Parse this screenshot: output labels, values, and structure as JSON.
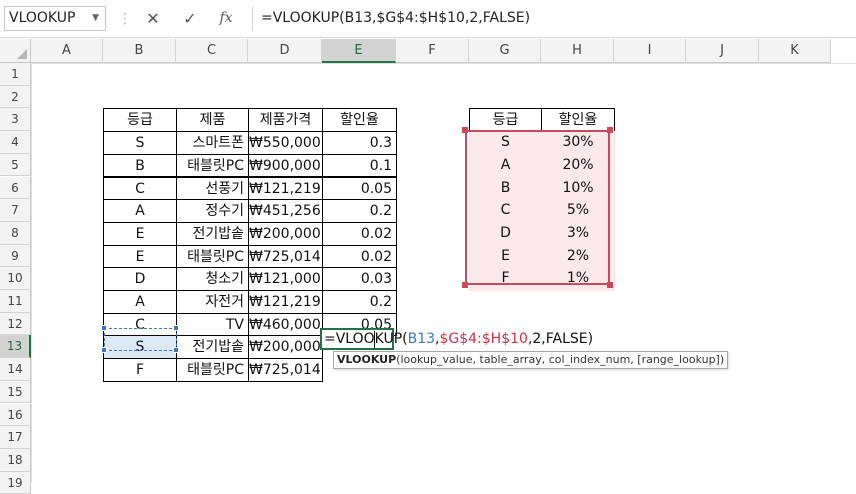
{
  "name_box": "VLOOKUP",
  "formula_bar": {
    "cancel_icon": "✕",
    "enter_icon": "✓",
    "fx_label": "fx",
    "formula": "=VLOOKUP(B13,$G$4:$H$10,2,FALSE)"
  },
  "columns": [
    "A",
    "B",
    "C",
    "D",
    "E",
    "F",
    "G",
    "H",
    "I",
    "J",
    "K"
  ],
  "rows": [
    "1",
    "2",
    "3",
    "4",
    "5",
    "6",
    "7",
    "8",
    "9",
    "10",
    "11",
    "12",
    "13",
    "14",
    "15",
    "16",
    "17",
    "18",
    "19"
  ],
  "table1": {
    "headers": [
      "등급",
      "제품",
      "제품가격",
      "할인율"
    ],
    "rows": [
      [
        "S",
        "스마트폰",
        "₩550,000",
        "0.3"
      ],
      [
        "B",
        "태블릿PC",
        "₩900,000",
        "0.1"
      ],
      [
        "C",
        "선풍기",
        "₩121,219",
        "0.05"
      ],
      [
        "A",
        "정수기",
        "₩451,256",
        "0.2"
      ],
      [
        "E",
        "전기밥솥",
        "₩200,000",
        "0.02"
      ],
      [
        "E",
        "태블릿PC",
        "₩725,014",
        "0.02"
      ],
      [
        "D",
        "청소기",
        "₩121,000",
        "0.03"
      ],
      [
        "A",
        "자전거",
        "₩121,219",
        "0.2"
      ],
      [
        "C",
        "TV",
        "₩460,000",
        "0.05"
      ],
      [
        "S",
        "전기밥솥",
        "₩200,000",
        ""
      ],
      [
        "F",
        "태블릿PC",
        "₩725,014",
        ""
      ]
    ]
  },
  "table2": {
    "headers": [
      "등급",
      "할인율"
    ],
    "rows": [
      [
        "S",
        "30%"
      ],
      [
        "A",
        "20%"
      ],
      [
        "B",
        "10%"
      ],
      [
        "C",
        "5%"
      ],
      [
        "D",
        "3%"
      ],
      [
        "E",
        "2%"
      ],
      [
        "F",
        "1%"
      ]
    ]
  },
  "edit": {
    "prefix": "=VLOOKUP(",
    "ref1": "B13",
    "comma1": ",",
    "ref2": "$G$4:$H$10",
    "suffix": ",2,FALSE)"
  },
  "tooltip": {
    "func": "VLOOKUP",
    "args": "(lookup_value, table_array, col_index_num, [range_lookup])"
  },
  "colors": {
    "accent_green": "#217346",
    "ref_blue": "#3a78c8",
    "ref_red": "#c8343f",
    "pink_fill": "#fbe9ea"
  }
}
